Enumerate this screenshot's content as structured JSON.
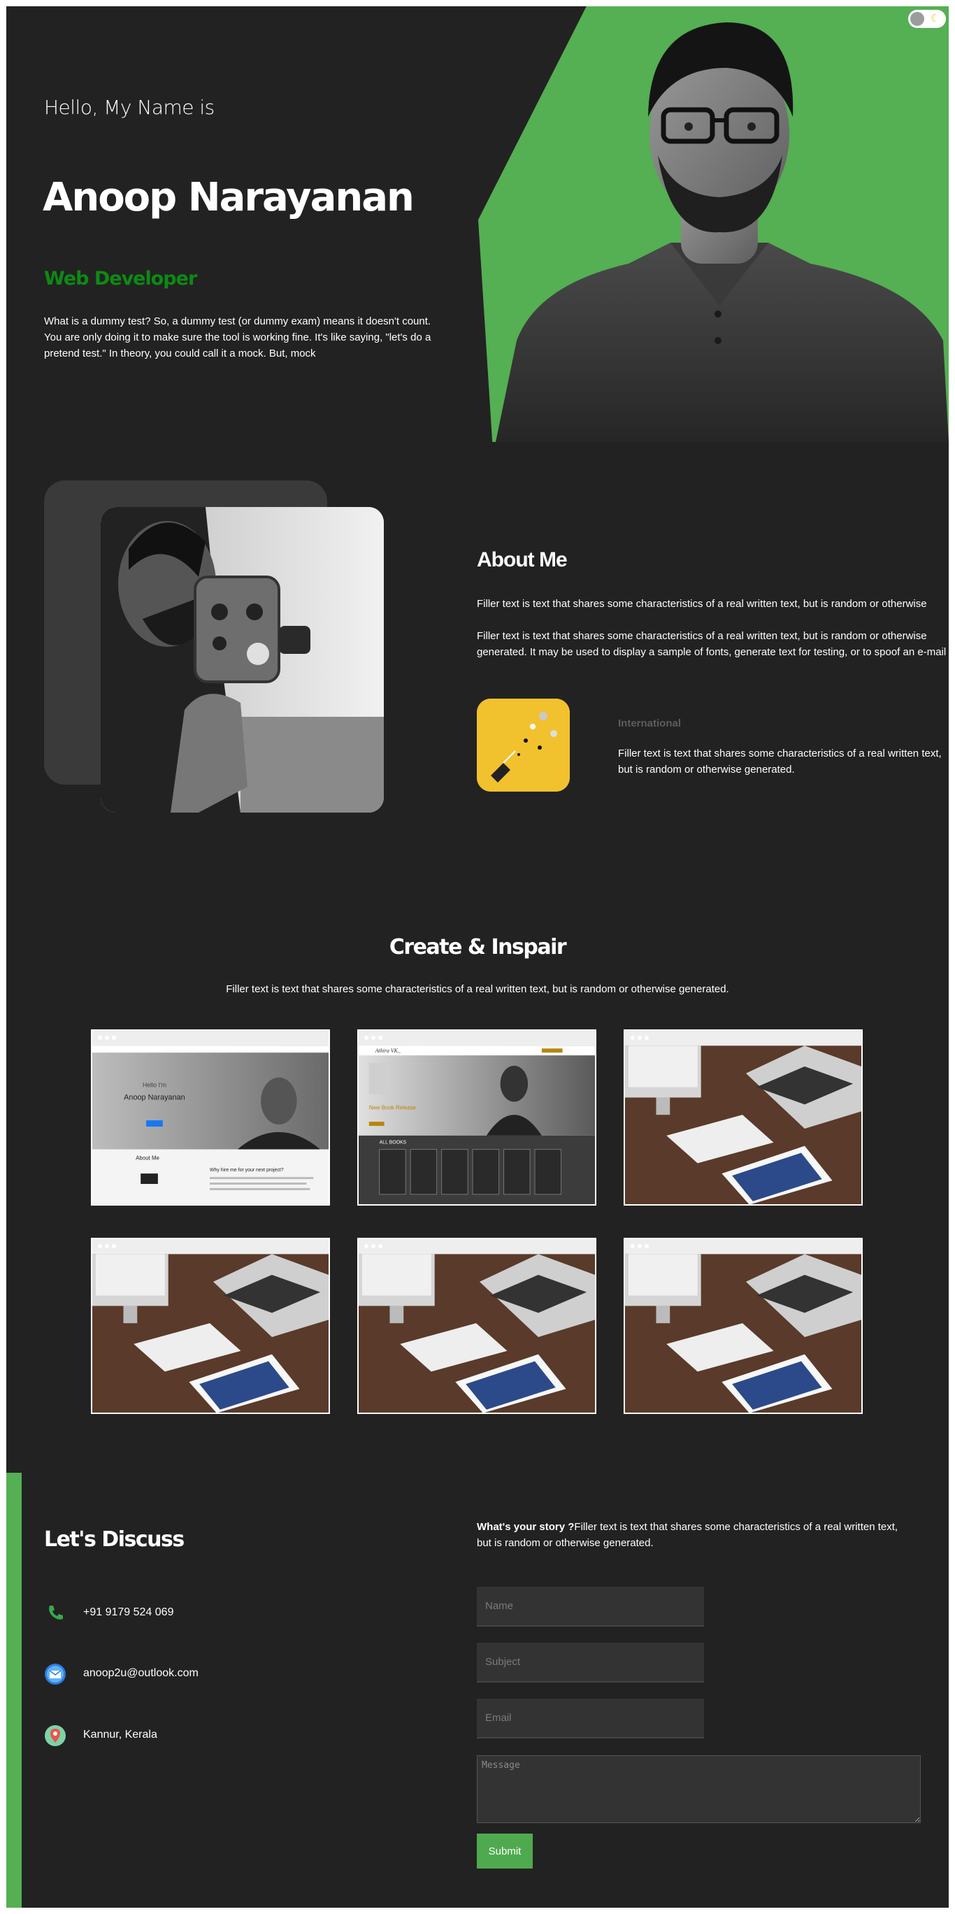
{
  "hero": {
    "greeting": "Hello, My Name is",
    "name": "Anoop Narayanan",
    "role": "Web Developer",
    "description": "What is a dummy test? So, a dummy test (or dummy exam) means it doesn't count. You are only doing it to make sure the tool is working fine. It's like saying, \"let's do a pretend test.\" In theory, you could call it a mock. But, mock",
    "accent_color": "#55af53",
    "role_color": "#0d8a13"
  },
  "theme_toggle": {
    "icon": "moon-icon"
  },
  "about": {
    "title": "About Me",
    "paragraph1": "Filler text is text that shares some characteristics of a real written text, but is random or otherwise",
    "paragraph2": "Filler text is text that shares some characteristics of a real written text, but is random or otherwise generated. It may be used to display a sample of fonts, generate text for testing, or to spoof an e-mail",
    "feature": {
      "label": "International",
      "description": "Filler text is text that shares some characteristics of a real written text, but is random or otherwise generated."
    }
  },
  "portfolio": {
    "title": "Create & Inspair",
    "subtitle": "Filler text is text that shares some characteristics of a real written text, but is random or otherwise generated.",
    "items": [
      {
        "kind": "site-anoop",
        "hello": "Hello I'm",
        "name": "Anoop Narayanan",
        "about": "About Me",
        "hire": "Why hire me for your next project?"
      },
      {
        "kind": "site-books",
        "brand": "Athira VK_",
        "tag": "New Book Release",
        "books": "ALL BOOKS"
      },
      {
        "kind": "desk"
      },
      {
        "kind": "desk"
      },
      {
        "kind": "desk"
      },
      {
        "kind": "desk"
      }
    ]
  },
  "contact": {
    "title": "Let's Discuss",
    "phone": "+91 9179 524 069",
    "email": "anoop2u@outlook.com",
    "location": "Kannur, Kerala",
    "story_bold": "What's your story ?",
    "story_text": "Filler text is text that shares some characteristics of a real written text, but is random or otherwise generated.",
    "form": {
      "name_placeholder": "Name",
      "subject_placeholder": "Subject",
      "email_placeholder": "Email",
      "message_placeholder": "Message",
      "submit_label": "Submit"
    }
  }
}
